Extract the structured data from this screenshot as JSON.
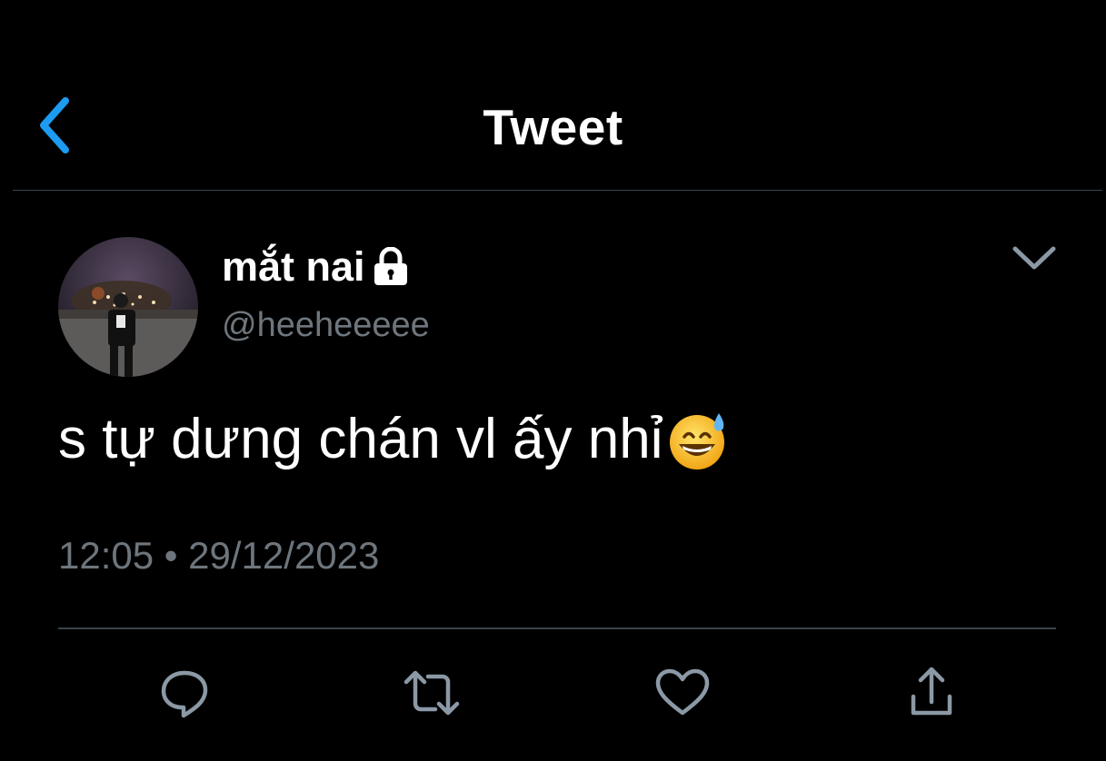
{
  "header": {
    "title": "Tweet",
    "back_icon": "chevron-left-icon",
    "accent_color": "#1d9bf0"
  },
  "tweet": {
    "author": {
      "display_name": "mắt nai",
      "handle": "@heeheeeee",
      "protected_icon": "lock-icon",
      "avatar": "profile-photo"
    },
    "text": "s tự dưng chán vl ấy nhỉ",
    "emoji": "grinning-face-with-sweat",
    "time": "12:05",
    "separator": "•",
    "date": "29/12/2023",
    "menu_icon": "chevron-down-icon"
  },
  "actions": [
    {
      "name": "reply",
      "icon": "reply-icon"
    },
    {
      "name": "retweet",
      "icon": "retweet-icon"
    },
    {
      "name": "like",
      "icon": "heart-icon"
    },
    {
      "name": "share",
      "icon": "share-icon"
    }
  ],
  "colors": {
    "background": "#000000",
    "text": "#ffffff",
    "secondary_text": "#6e767d",
    "divider": "#38444d",
    "icon": "#8b98a5"
  }
}
